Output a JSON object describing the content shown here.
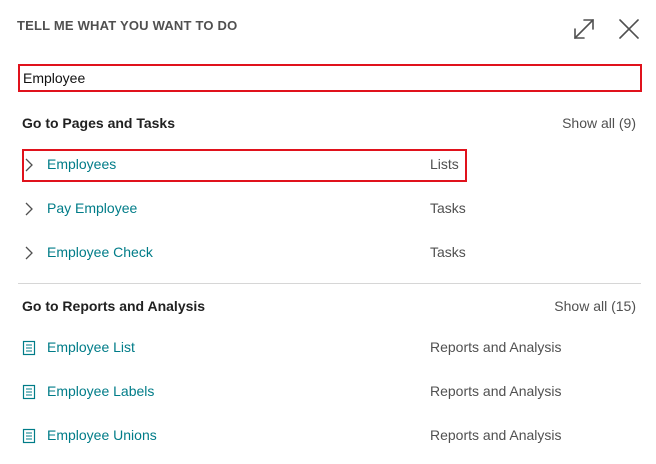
{
  "dialog": {
    "title": "TELL ME WHAT YOU WANT TO DO"
  },
  "search": {
    "value": "Employee",
    "placeholder": ""
  },
  "icons": {
    "expand": "expand-diagonal-icon",
    "close": "close-x-icon",
    "page": "chevron-right-icon",
    "report": "report-document-icon"
  },
  "colors": {
    "accent": "#007c88",
    "highlight": "#e0121c"
  },
  "pages_section": {
    "header": "Go to Pages and Tasks",
    "show_all": "Show all (9)",
    "items": [
      {
        "label": "Employees",
        "category": "Lists"
      },
      {
        "label": "Pay Employee",
        "category": "Tasks"
      },
      {
        "label": "Employee Check",
        "category": "Tasks"
      }
    ]
  },
  "reports_section": {
    "header": "Go to Reports and Analysis",
    "show_all": "Show all (15)",
    "items": [
      {
        "label": "Employee List",
        "category": "Reports and Analysis"
      },
      {
        "label": "Employee Labels",
        "category": "Reports and Analysis"
      },
      {
        "label": "Employee Unions",
        "category": "Reports and Analysis"
      }
    ]
  }
}
